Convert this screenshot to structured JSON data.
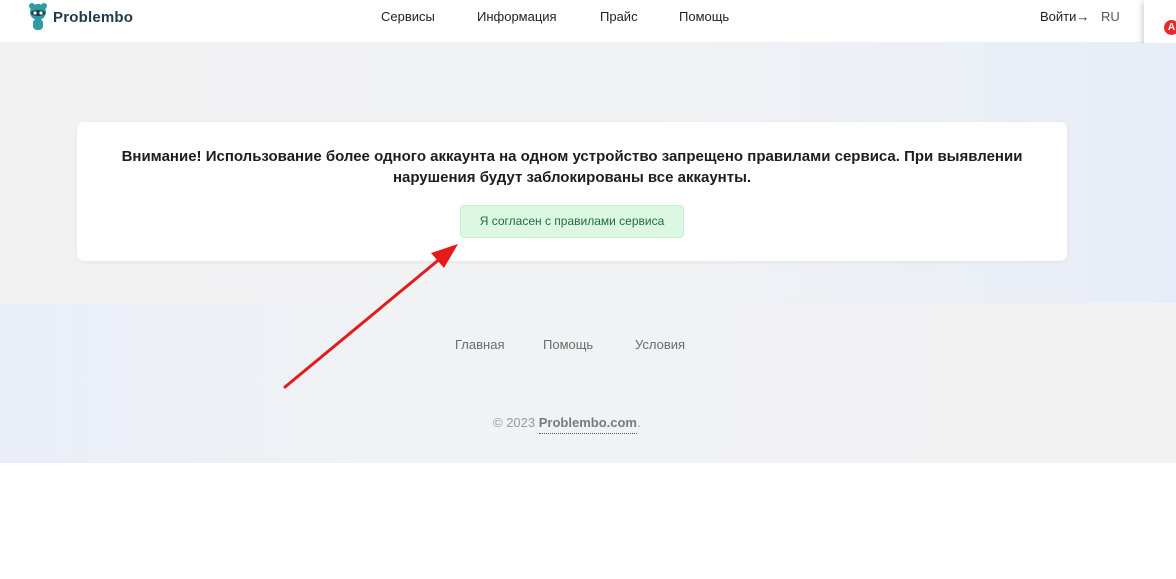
{
  "header": {
    "brand": "Problembo",
    "nav": [
      "Сервисы",
      "Информация",
      "Прайс",
      "Помощь"
    ],
    "login_label": "Войти→",
    "lang": "RU"
  },
  "extension": {
    "badge": "A"
  },
  "notice": {
    "text": "Внимание! Использование более одного аккаунта на одном устройство запрещено правилами сервиса. При выявлении нарушения будут заблокированы все аккаунты.",
    "agree_button": "Я согласен с правилами сервиса"
  },
  "footer": {
    "links": [
      "Главная",
      "Помощь",
      "Условия"
    ],
    "copyright_prefix": "© 2023 ",
    "copyright_brand": "Problembo.com",
    "copyright_suffix": "."
  },
  "colors": {
    "annotation_arrow": "#e31b1b",
    "agree_button_bg": "#dcf8e3",
    "brand_text": "#1f3a4d"
  }
}
